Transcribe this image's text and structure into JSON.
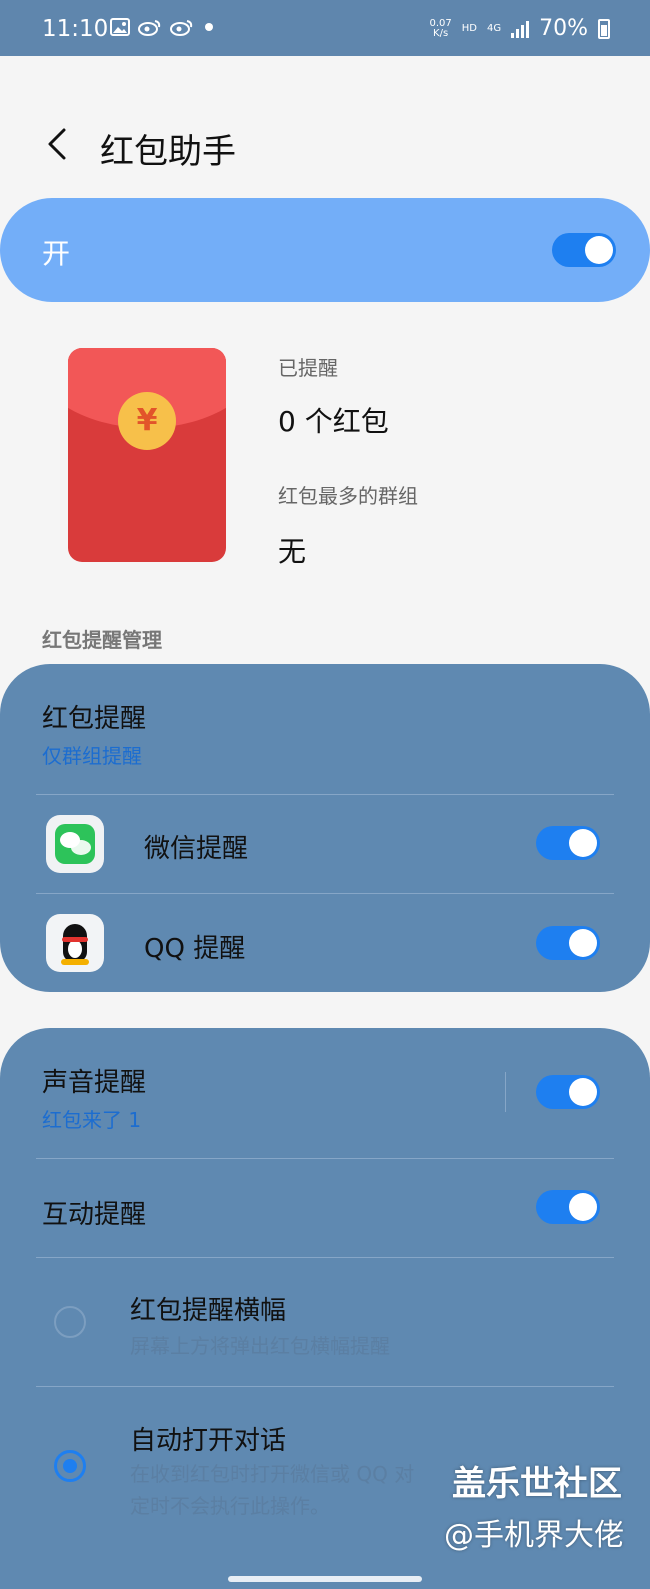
{
  "status_bar": {
    "time": "11:10",
    "speed_value": "0.07",
    "speed_unit": "K/s",
    "hd": "HD",
    "network": "4G",
    "battery": "70%"
  },
  "header": {
    "title": "红包助手"
  },
  "master": {
    "label": "开",
    "enabled": true
  },
  "stats": {
    "reminded_label": "已提醒",
    "reminded_value": "0 个红包",
    "group_label": "红包最多的群组",
    "group_value": "无"
  },
  "section_title": "红包提醒管理",
  "card1": {
    "reminder_title": "红包提醒",
    "reminder_sub": "仅群组提醒",
    "wechat_label": "微信提醒",
    "qq_label": "QQ 提醒"
  },
  "card2": {
    "sound_title": "声音提醒",
    "sound_sub": "红包来了 1",
    "interact_title": "互动提醒",
    "banner_title": "红包提醒横幅",
    "banner_desc": "屏幕上方将弹出红包横幅提醒",
    "auto_title": "自动打开对话",
    "auto_desc1": "在收到红包时打开微信或 QQ 对",
    "auto_desc2": "定时不会执行此操作。"
  },
  "watermark": {
    "line1": "盖乐世社区",
    "line2": "@手机界大佬"
  },
  "colors": {
    "accent": "#1e7ff0",
    "master_bg": "#73aef8",
    "card_bg": "#5f89b1"
  }
}
